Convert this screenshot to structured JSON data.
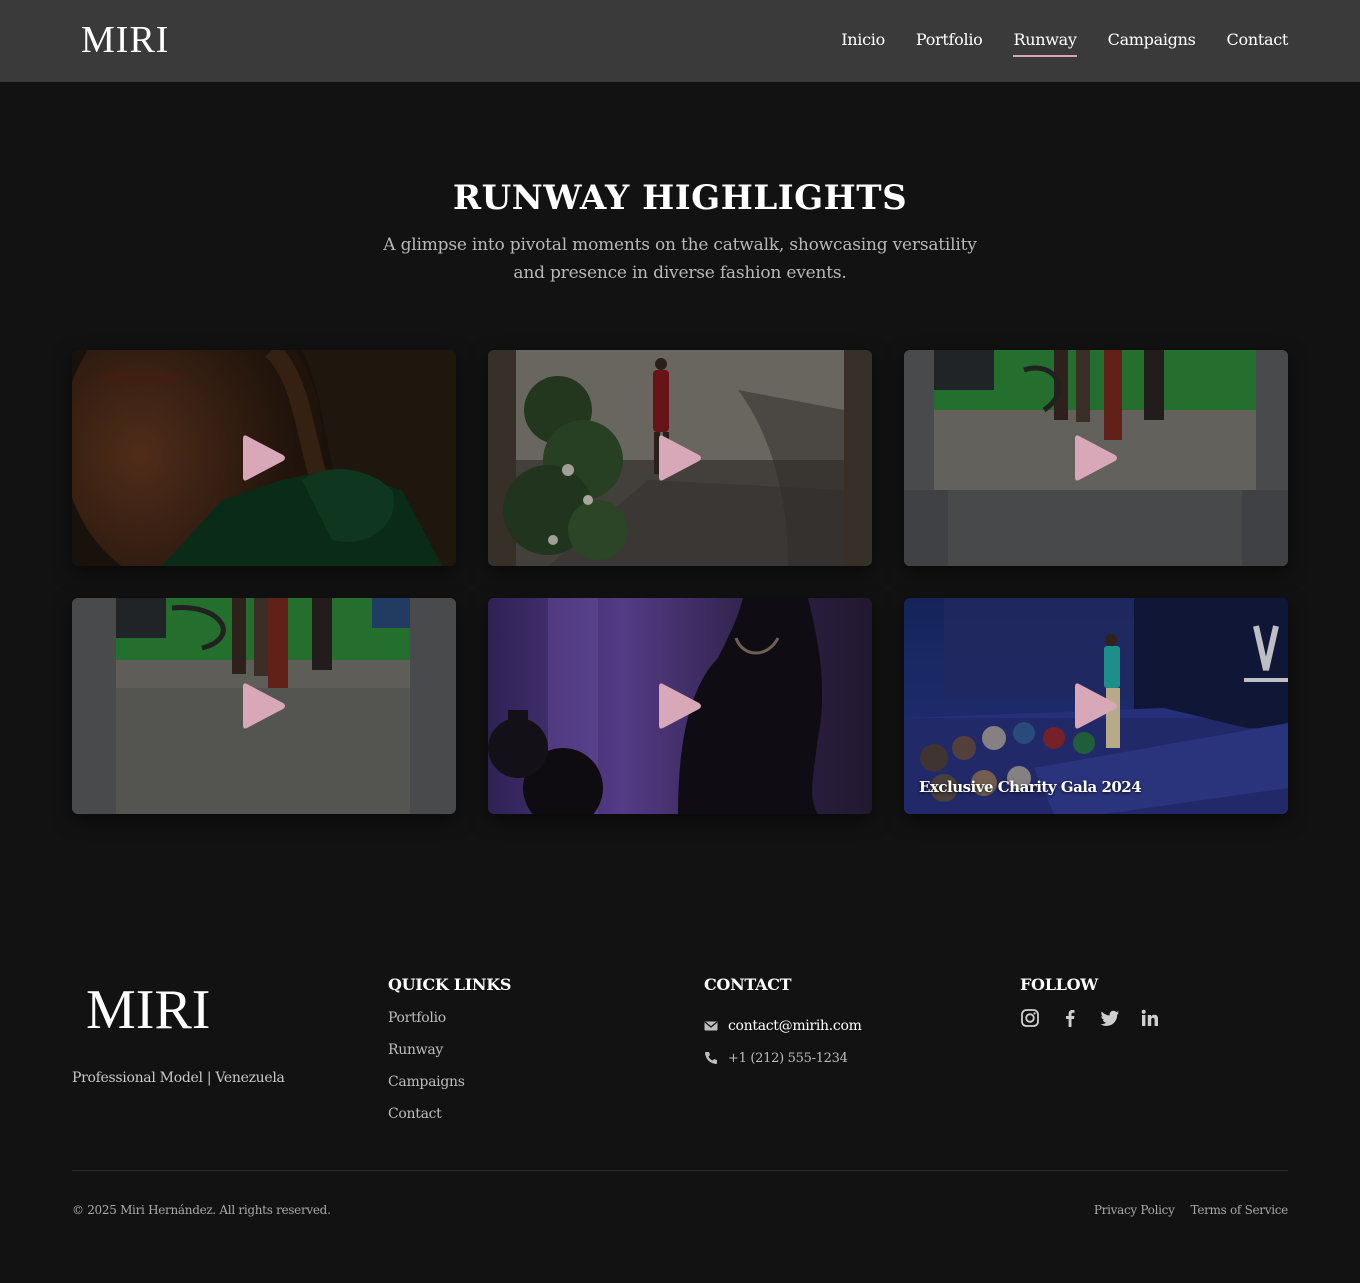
{
  "header": {
    "logo": "MIRI",
    "nav": [
      {
        "label": "Inicio",
        "active": false
      },
      {
        "label": "Portfolio",
        "active": false
      },
      {
        "label": "Runway",
        "active": true
      },
      {
        "label": "Campaigns",
        "active": false
      },
      {
        "label": "Contact",
        "active": false
      }
    ]
  },
  "hero": {
    "title": "RUNWAY HIGHLIGHTS",
    "subtitle": "A glimpse into pivotal moments on the catwalk, showcasing versatility and presence in diverse fashion events."
  },
  "videos": [
    {
      "scene": "close-up portrait, green dress",
      "caption": ""
    },
    {
      "scene": "outdoor runway, red suit",
      "caption": ""
    },
    {
      "scene": "studio runway, green backdrop",
      "caption": ""
    },
    {
      "scene": "studio runway, green backdrop",
      "caption": ""
    },
    {
      "scene": "purple lit silhouette",
      "caption": ""
    },
    {
      "scene": "gala runway with audience",
      "caption": "Exclusive Charity Gala 2024"
    }
  ],
  "play_icon": "play-icon",
  "footer": {
    "logo": "MIRI",
    "tagline": "Professional Model | Venezuela",
    "quick_links": {
      "heading": "QUICK LINKS",
      "items": [
        "Portfolio",
        "Runway",
        "Campaigns",
        "Contact"
      ]
    },
    "contact": {
      "heading": "CONTACT",
      "email": "contact@mirih.com",
      "phone": "+1 (212) 555-1234"
    },
    "follow": {
      "heading": "FOLLOW",
      "icons": [
        "instagram-icon",
        "facebook-icon",
        "twitter-icon",
        "linkedin-icon"
      ]
    },
    "copyright": "© 2025 Miri Hernández. All rights reserved.",
    "legal": [
      "Privacy Policy",
      "Terms of Service"
    ]
  },
  "colors": {
    "background": "#121212",
    "header": "#3a3a3a",
    "accent": "#d8a7b8"
  }
}
